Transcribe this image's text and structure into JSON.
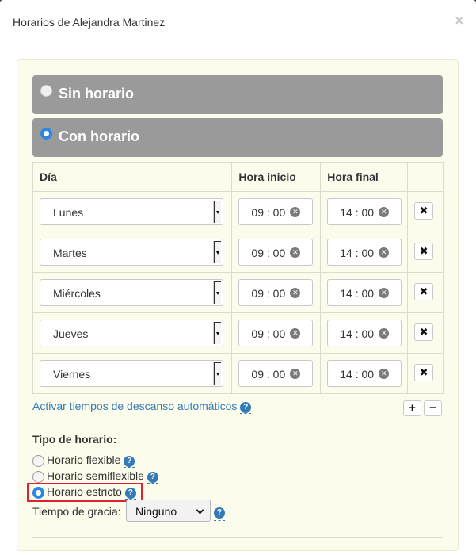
{
  "modal": {
    "title": "Horarios de Alejandra Martinez",
    "close_label": "×"
  },
  "options": {
    "sin_horario": "Sin horario",
    "con_horario": "Con horario",
    "selected": "con_horario"
  },
  "table": {
    "headers": {
      "day": "Día",
      "start": "Hora inicio",
      "end": "Hora final"
    },
    "rows": [
      {
        "day": "Lunes",
        "start": "09 : 00",
        "end": "14 : 00"
      },
      {
        "day": "Martes",
        "start": "09 : 00",
        "end": "14 : 00"
      },
      {
        "day": "Miércoles",
        "start": "09 : 00",
        "end": "14 : 00"
      },
      {
        "day": "Jueves",
        "start": "09 : 00",
        "end": "14 : 00"
      },
      {
        "day": "Viernes",
        "start": "09 : 00",
        "end": "14 : 00"
      }
    ],
    "delete_glyph": "✖",
    "clear_glyph": "✕"
  },
  "auto_break": {
    "label": "Activar tiempos de descanso automáticos"
  },
  "buttons": {
    "plus": "+",
    "minus": "−"
  },
  "tipo": {
    "title": "Tipo de horario:",
    "flexible": "Horario flexible",
    "semiflexible": "Horario semiflexible",
    "estricto": "Horario estricto",
    "selected": "estricto"
  },
  "gracia": {
    "label": "Tiempo de gracia:",
    "value": "Ninguno"
  },
  "help_glyph": "?",
  "colors": {
    "accent": "#337ab7",
    "radio_checked": "#2b87e4",
    "panel_bg": "#fcfcec",
    "bar_bg": "#9a9a9a",
    "highlight": "#e0212e"
  }
}
